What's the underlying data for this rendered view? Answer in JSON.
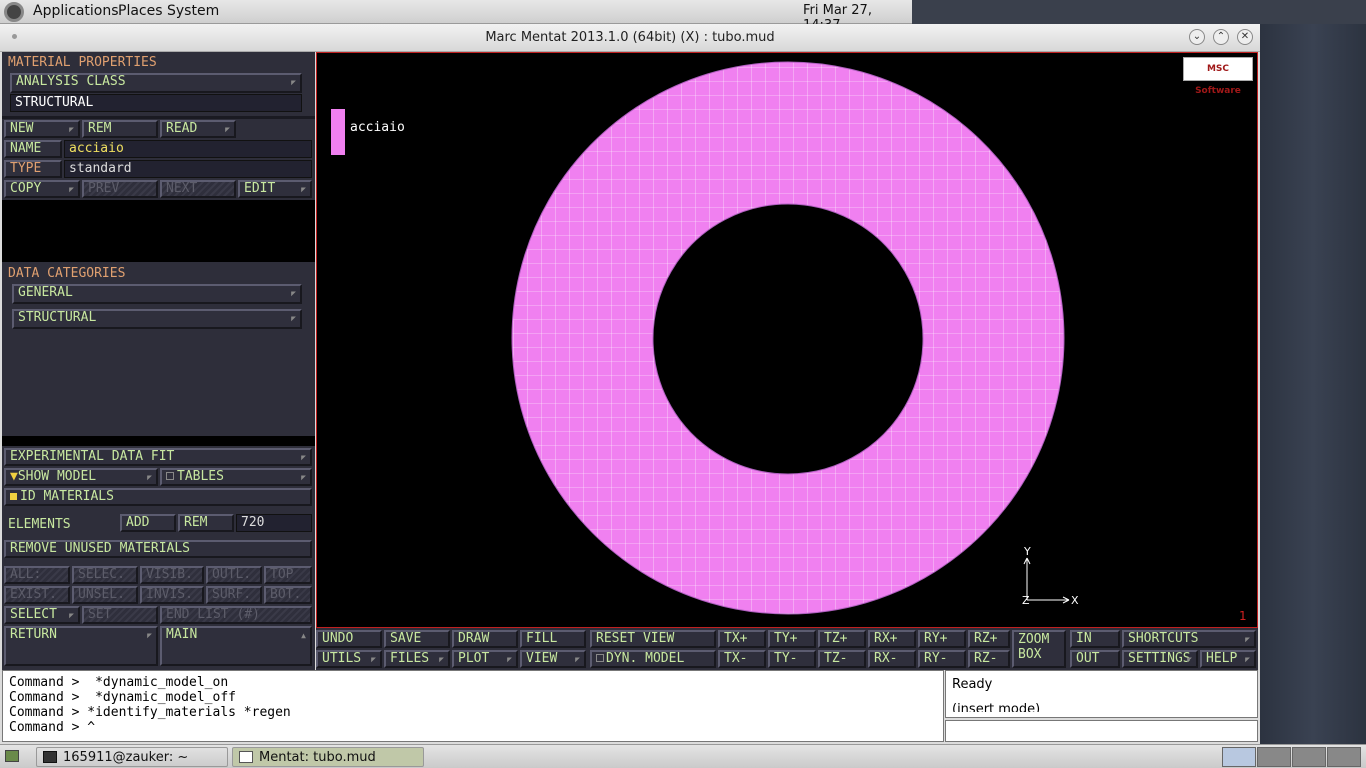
{
  "topbar": {
    "menu": [
      "Applications",
      "Places",
      "System"
    ],
    "clock": "Fri Mar 27, 14:37"
  },
  "window": {
    "title": "Marc Mentat 2013.1.0 (64bit) (X) : tubo.mud"
  },
  "panel": {
    "header": "MATERIAL PROPERTIES",
    "analysis_class": "ANALYSIS CLASS",
    "structural_value": "STRUCTURAL",
    "new": "NEW",
    "rem": "REM",
    "read": "READ",
    "name_label": "NAME",
    "name_value": "acciaio",
    "type_label": "TYPE",
    "type_value": "standard",
    "copy": "COPY",
    "prev": "PREV",
    "next": "NEXT",
    "edit": "EDIT",
    "data_categories": "DATA CATEGORIES",
    "general": "GENERAL",
    "structural": "STRUCTURAL",
    "exp_fit": "EXPERIMENTAL DATA FIT",
    "show_model": "SHOW MODEL",
    "tables": "TABLES",
    "id_materials": "ID MATERIALS",
    "elements_label": "ELEMENTS",
    "add": "ADD",
    "el_rem": "REM",
    "elements_count": "720",
    "remove_unused": "REMOVE UNUSED MATERIALS",
    "sel_row1": [
      "ALL:",
      "SELEC.",
      "VISIB.",
      "OUTL.",
      "TOP"
    ],
    "sel_row2": [
      "EXIST.",
      "UNSEL.",
      "INVIS.",
      "SURF.",
      "BOT."
    ],
    "select": "SELECT",
    "set": "SET",
    "end_list": "END LIST (#)",
    "return": "RETURN",
    "main": "MAIN"
  },
  "viewport": {
    "legend": "acciaio",
    "logo": "MSC Software",
    "axis_x": "X",
    "axis_y": "Y",
    "axis_z": "Z",
    "corner": "1",
    "mesh_color": "#f080f0"
  },
  "toolbar": {
    "row1": [
      "UNDO",
      "SAVE",
      "DRAW",
      "FILL",
      "RESET VIEW",
      "TX+",
      "TY+",
      "TZ+",
      "RX+",
      "RY+",
      "RZ+"
    ],
    "row2": [
      "UTILS",
      "FILES",
      "PLOT",
      "VIEW",
      "DYN. MODEL",
      "TX-",
      "TY-",
      "TZ-",
      "RX-",
      "RY-",
      "RZ-"
    ],
    "zoom_box": "ZOOM BOX",
    "in": "IN",
    "out": "OUT",
    "shortcuts": "SHORTCUTS",
    "settings": "SETTINGS",
    "help": "HELP"
  },
  "command": {
    "lines": [
      "Command >  *dynamic_model_on",
      "Command >  *dynamic_model_off",
      "Command > *identify_materials *regen",
      "Command > ^"
    ]
  },
  "status": {
    "ready": "Ready",
    "mode": "(insert mode)"
  },
  "taskbar": {
    "items": [
      "165911@zauker: ~",
      "Mentat: tubo.mud"
    ]
  }
}
